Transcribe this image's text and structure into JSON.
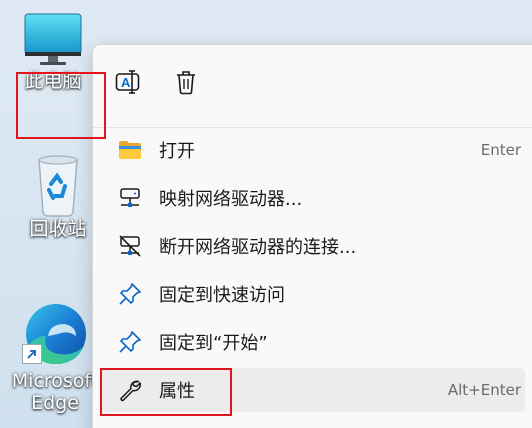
{
  "desktop": {
    "icons": [
      {
        "label": "此电脑",
        "icon": "monitor-icon"
      },
      {
        "label": "回收站",
        "icon": "recycle-bin-icon"
      },
      {
        "label_line1": "Microsoft",
        "label_line2": "Edge",
        "icon": "edge-icon"
      }
    ]
  },
  "context_menu": {
    "toolbar": [
      {
        "icon": "rename-icon"
      },
      {
        "icon": "trash-icon"
      }
    ],
    "items": [
      {
        "label": "打开",
        "shortcut": "Enter",
        "icon": "folder-icon"
      },
      {
        "label": "映射网络驱动器...",
        "shortcut": "",
        "icon": "network-drive-icon"
      },
      {
        "label": "断开网络驱动器的连接...",
        "shortcut": "",
        "icon": "disconnect-drive-icon"
      },
      {
        "label": "固定到快速访问",
        "shortcut": "",
        "icon": "pin-icon"
      },
      {
        "label": "固定到“开始”",
        "shortcut": "",
        "icon": "pin-icon"
      },
      {
        "label": "属性",
        "shortcut": "Alt+Enter",
        "icon": "wrench-icon"
      }
    ]
  },
  "colors": {
    "highlight_red": "#e2141c",
    "accent_blue": "#0a67c8",
    "menu_bg": "#f9f9f9"
  }
}
